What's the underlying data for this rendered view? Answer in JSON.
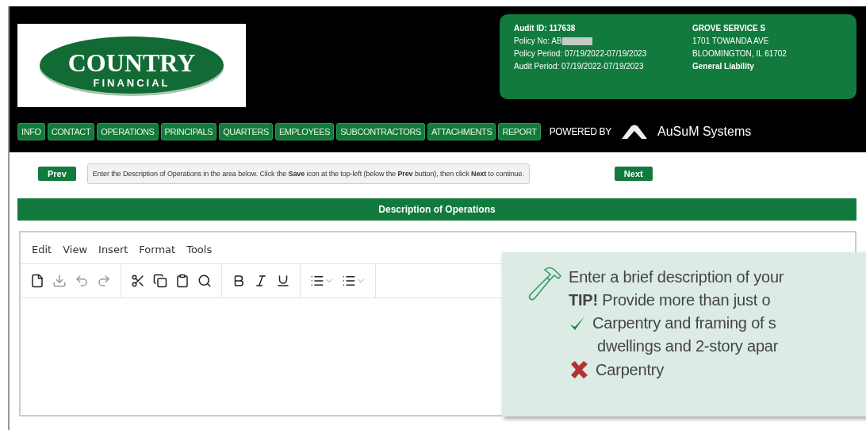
{
  "logo": {
    "title": "COUNTRY",
    "subtitle": "FINANCIAL"
  },
  "audit_info": {
    "left": [
      "Audit ID: 117638",
      "Policy No: AB",
      "Policy Period: 07/19/2022-07/19/2023",
      "Audit Period: 07/19/2022-07/19/2023"
    ],
    "right": [
      "GROVE SERVICE S",
      "1701 TOWANDA AVE",
      "BLOOMINGTON, IL 61702",
      "General Liability"
    ]
  },
  "nav": [
    "INFO",
    "CONTACT",
    "OPERATIONS",
    "PRINCIPALS",
    "QUARTERS",
    "EMPLOYEES",
    "SUBCONTRACTORS",
    "ATTACHMENTS",
    "REPORT"
  ],
  "powered_by": {
    "label": "POWERED BY",
    "brand": "AuSuM Systems"
  },
  "prev_button": "Prev",
  "instruction": "Enter the Description of Operations in the area below. Click the **Save** icon at the top-left (below the **Prev** button), then click **Next** to continue.",
  "next_button": "Next",
  "section_title": "Description of Operations",
  "editor": {
    "menu": [
      "Edit",
      "View",
      "Insert",
      "Format",
      "Tools"
    ],
    "toolbar": [
      [
        {
          "kind": "new",
          "disabled": false
        },
        {
          "kind": "save",
          "disabled": true
        },
        {
          "kind": "undo",
          "disabled": true
        },
        {
          "kind": "redo",
          "disabled": true
        }
      ],
      [
        {
          "kind": "cut",
          "disabled": false
        },
        {
          "kind": "copy",
          "disabled": false
        },
        {
          "kind": "paste",
          "disabled": false
        },
        {
          "kind": "find",
          "disabled": false
        }
      ],
      [
        {
          "kind": "bold",
          "disabled": false
        },
        {
          "kind": "italic",
          "disabled": false
        },
        {
          "kind": "underline",
          "disabled": false
        }
      ],
      [
        {
          "kind": "bullets",
          "disabled": false
        },
        {
          "kind": "numbers",
          "disabled": false
        }
      ]
    ]
  },
  "tooltip": {
    "lines": [
      {
        "kind": "plain",
        "text": "Enter a brief description of your"
      },
      {
        "kind": "plain",
        "text": "**TIP!** Provide more than just o"
      },
      {
        "kind": "good",
        "text": "Carpentry and framing of s"
      },
      {
        "kind": "indent",
        "text": "dwellings and 2-story apar"
      },
      {
        "kind": "bad",
        "text": "Carpentry"
      }
    ]
  }
}
